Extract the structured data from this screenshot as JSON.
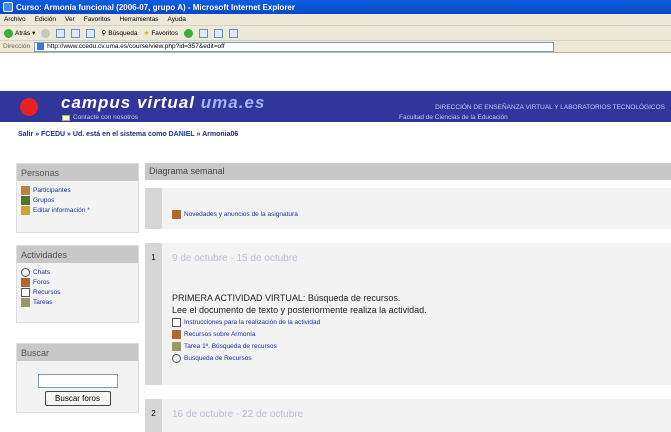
{
  "window": {
    "title": "Curso: Armonía funcional (2006-07, grupo A) - Microsoft Internet Explorer"
  },
  "menu": [
    "Archivo",
    "Edición",
    "Ver",
    "Favoritos",
    "Herramientas",
    "Ayuda"
  ],
  "toolbar": {
    "back": "Atrás",
    "search": "Búsqueda",
    "favorites": "Favoritos"
  },
  "address": {
    "label": "Dirección",
    "url": "http://www.ccedu.cv.uma.es/course/view.php?id=357&edit=off"
  },
  "banner": {
    "logo_a": "campus virtual",
    "logo_b": "uma.es",
    "direction": "DIRECCIÓN DE ENSEÑANZA VIRTUAL Y LABORATORIOS TECNOLÓGICOS",
    "contact": "Contacte con nosotros",
    "faculty": "Facultad de Ciencias de la Educación"
  },
  "breadcrumb": {
    "exit": "Salir",
    "sep": " » ",
    "course": "FCEDU",
    "logged_prefix": "Ud. está en el sistema como",
    "user": "DANIEL",
    "code": "Armonia06"
  },
  "personas": {
    "title": "Personas",
    "items": [
      "Participantes",
      "Grupos",
      "Editar información *"
    ]
  },
  "actividades": {
    "title": "Actividades",
    "items": [
      "Chats",
      "Foros",
      "Recursos",
      "Tareas"
    ]
  },
  "buscar": {
    "title": "Buscar",
    "button": "Buscar foros",
    "value": ""
  },
  "diagram": {
    "title": "Diagrama semanal"
  },
  "intro": {
    "news": "Novedades y anuncios de la asignatura"
  },
  "week1": {
    "num": "1",
    "dates": "9 de octubre - 15 de octubre",
    "heading": "PRIMERA ACTIVIDAD VIRTUAL: Búsqueda de recursos.",
    "desc": "Lee el documento de texto y posteriormente realiza la actividad.",
    "items": [
      "Instrucciones para la realización de la actividad",
      "Recursos sobre Armonía",
      "Tarea 1ª. Búsqueda de recursos",
      "Busqueda de Recursos"
    ]
  },
  "week2": {
    "num": "2",
    "dates": "16 de octubre - 22 de octubre"
  }
}
